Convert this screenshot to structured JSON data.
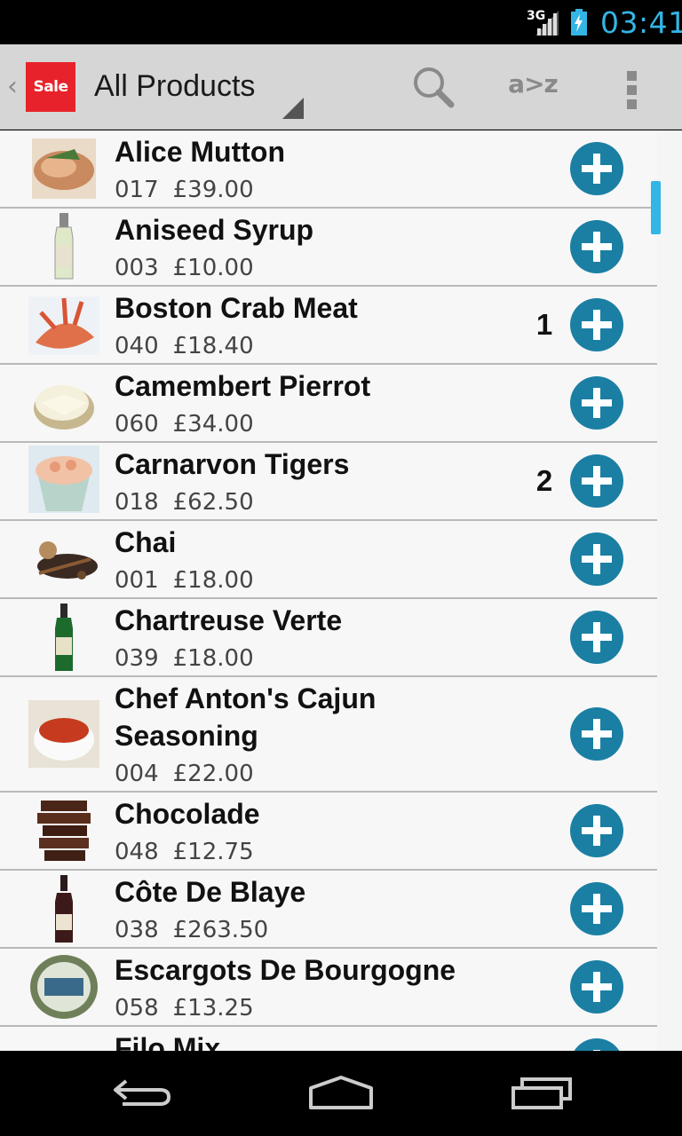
{
  "status_bar": {
    "network_label": "3G",
    "time": "03:41",
    "signal_icon": "signal-bars-icon",
    "battery_icon": "battery-charging-icon",
    "accent_color": "#33b5e5"
  },
  "action_bar": {
    "up_caret": "‹",
    "app_logo_text": "Sale",
    "title": "All Products",
    "search_icon": "search-icon",
    "sort_label": "a>z",
    "overflow_icon": "overflow-menu-icon",
    "brand_color": "#e8222a"
  },
  "products": [
    {
      "name": "Alice Mutton",
      "code": "017",
      "price": "£39.00",
      "qty": "",
      "thumb_icon": "roast-meat-icon"
    },
    {
      "name": "Aniseed Syrup",
      "code": "003",
      "price": "£10.00",
      "qty": "",
      "thumb_icon": "bottle-icon"
    },
    {
      "name": "Boston Crab Meat",
      "code": "040",
      "price": "£18.40",
      "qty": "1",
      "thumb_icon": "crab-icon"
    },
    {
      "name": "Camembert Pierrot",
      "code": "060",
      "price": "£34.00",
      "qty": "",
      "thumb_icon": "cheese-icon"
    },
    {
      "name": "Carnarvon Tigers",
      "code": "018",
      "price": "£62.50",
      "qty": "2",
      "thumb_icon": "prawn-cocktail-icon"
    },
    {
      "name": "Chai",
      "code": "001",
      "price": "£18.00",
      "qty": "",
      "thumb_icon": "tea-icon"
    },
    {
      "name": "Chartreuse Verte",
      "code": "039",
      "price": "£18.00",
      "qty": "",
      "thumb_icon": "liqueur-bottle-icon"
    },
    {
      "name": "Chef Anton's Cajun\nSeasoning",
      "code": "004",
      "price": "£22.00",
      "qty": "",
      "thumb_icon": "spice-bowl-icon"
    },
    {
      "name": "Chocolade",
      "code": "048",
      "price": "£12.75",
      "qty": "",
      "thumb_icon": "chocolate-icon"
    },
    {
      "name": "Côte De Blaye",
      "code": "038",
      "price": "£263.50",
      "qty": "",
      "thumb_icon": "wine-bottle-icon"
    },
    {
      "name": "Escargots De Bourgogne",
      "code": "058",
      "price": "£13.25",
      "qty": "",
      "thumb_icon": "escargot-tin-icon"
    },
    {
      "name": "Filo Mix",
      "code": "",
      "price": "",
      "qty": "",
      "thumb_icon": "filo-icon"
    }
  ],
  "add_button_icon": "add-circle-icon",
  "add_button_color": "#1b7fa3",
  "nav_bar": {
    "back_icon": "back-icon",
    "home_icon": "home-icon",
    "recents_icon": "recent-apps-icon"
  }
}
